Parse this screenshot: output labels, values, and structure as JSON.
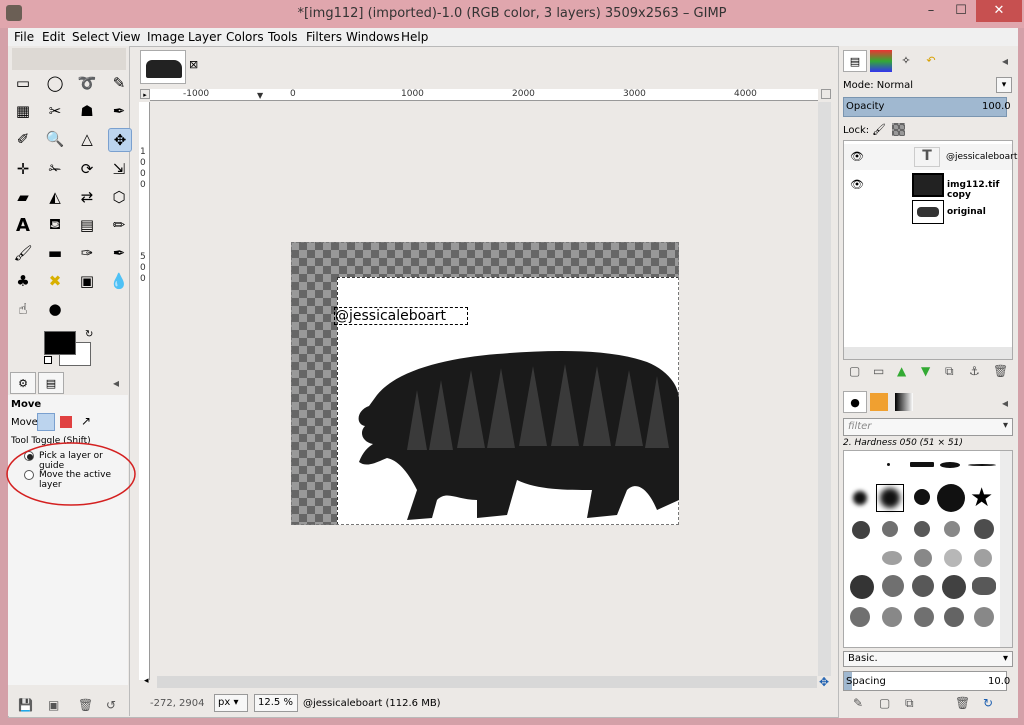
{
  "window": {
    "title": "*[img112] (imported)-1.0 (RGB color, 3 layers) 3509x2563 – GIMP",
    "min": "–",
    "max": "☐",
    "close": "✕"
  },
  "menu": [
    "File",
    "Edit",
    "Select",
    "View",
    "Image",
    "Layer",
    "Colors",
    "Tools",
    "Filters",
    "Windows",
    "Help"
  ],
  "image_tab": {
    "close": "⊠"
  },
  "rulers": {
    "top": [
      "-1000",
      "0",
      "1000",
      "2000",
      "3000",
      "4000"
    ],
    "left": [
      "1",
      "0",
      "0",
      "0",
      "5",
      "0",
      "0"
    ]
  },
  "canvas": {
    "text_layer": "@jessicaleboart"
  },
  "tool_options": {
    "title": "Move",
    "move_label": "Move:",
    "toggle_label": "Tool Toggle  (Shift)",
    "options": [
      {
        "label": "Pick a layer or guide",
        "selected": true
      },
      {
        "label": "Move the active layer",
        "selected": false
      }
    ]
  },
  "status": {
    "coords": "-272, 2904",
    "unit": "px",
    "zoom": "12.5 %",
    "message": "@jessicaleboart (112.6 MB)"
  },
  "layers_panel": {
    "mode_label": "Mode: Normal",
    "opacity_label": "Opacity",
    "opacity_value": "100.0",
    "lock_label": "Lock:",
    "layers": [
      {
        "name": "@jessicaleboart",
        "visible": true,
        "type": "text"
      },
      {
        "name": "img112.tif copy",
        "visible": true,
        "type": "image"
      },
      {
        "name": "original",
        "visible": false,
        "type": "image"
      }
    ]
  },
  "brushes_panel": {
    "filter_placeholder": "filter",
    "brush_name": "2. Hardness 050 (51 × 51)",
    "preset": "Basic.",
    "spacing_label": "Spacing",
    "spacing_value": "10.0"
  },
  "colors": {
    "accent": "#bcd4ee",
    "titlebar": "#e0a6ad",
    "close": "#c75050",
    "annotation": "#d42020"
  }
}
